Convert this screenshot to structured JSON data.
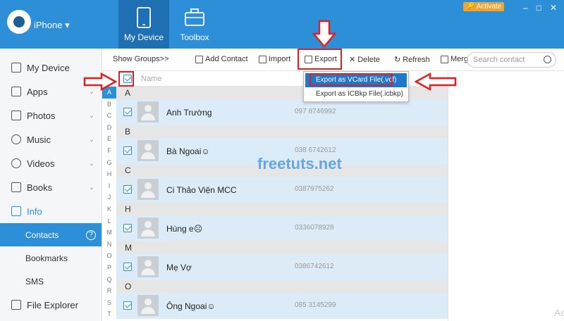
{
  "header": {
    "device_name": "iPhone ▾",
    "tabs": [
      {
        "label": "My Device"
      },
      {
        "label": "Toolbox"
      }
    ],
    "activate_label": "Activate",
    "window_buttons": [
      "–",
      "□",
      "✕"
    ]
  },
  "sidebar": {
    "items": [
      {
        "label": "My Device"
      },
      {
        "label": "Apps"
      },
      {
        "label": "Photos"
      },
      {
        "label": "Music"
      },
      {
        "label": "Videos"
      },
      {
        "label": "Books"
      },
      {
        "label": "Info"
      }
    ],
    "sub_items": [
      {
        "label": "Contacts"
      },
      {
        "label": "Bookmarks"
      },
      {
        "label": "SMS"
      }
    ],
    "file_explorer": "File Explorer"
  },
  "toolbar": {
    "show_groups": "Show Groups>>",
    "add_contact": "Add Contact",
    "import": "Import",
    "export": "Export",
    "delete": "Delete",
    "refresh": "Refresh",
    "merge": "Merg",
    "search_placeholder": "Search contact"
  },
  "list_header": {
    "name": "Name"
  },
  "export_menu": {
    "vcard": "Export as VCard File(.vcf)",
    "icbkp": "Export as ICBkp File(.icbkp)"
  },
  "alpha_index": [
    "A",
    "B",
    "C",
    "D",
    "E",
    "F",
    "G",
    "H",
    "I",
    "J",
    "K",
    "L",
    "M",
    "N",
    "O",
    "P",
    "Q",
    "R",
    "S",
    "T"
  ],
  "groups": [
    {
      "letter": "A",
      "contacts": [
        {
          "name": "Anh Trường",
          "phone": "097 8746992"
        }
      ]
    },
    {
      "letter": "B",
      "contacts": [
        {
          "name": "Bà Ngoai☺",
          "phone": "038 6742612"
        }
      ]
    },
    {
      "letter": "C",
      "contacts": [
        {
          "name": "Ci Thảo Viện MCC",
          "phone": "0387975262"
        }
      ]
    },
    {
      "letter": "H",
      "contacts": [
        {
          "name": "Hùng e☹",
          "phone": "0336078928"
        }
      ]
    },
    {
      "letter": "M",
      "contacts": [
        {
          "name": "Mẹ Vợ",
          "phone": "0386742612"
        }
      ]
    },
    {
      "letter": "O",
      "contacts": [
        {
          "name": "Ông Ngoai☺",
          "phone": "085 3145299"
        }
      ]
    }
  ],
  "watermark": "freetuts.net",
  "corner_text": "Ac",
  "colors": {
    "primary": "#2d8fd8",
    "highlight_row": "#dcebf8",
    "annotation": "#e02020"
  }
}
